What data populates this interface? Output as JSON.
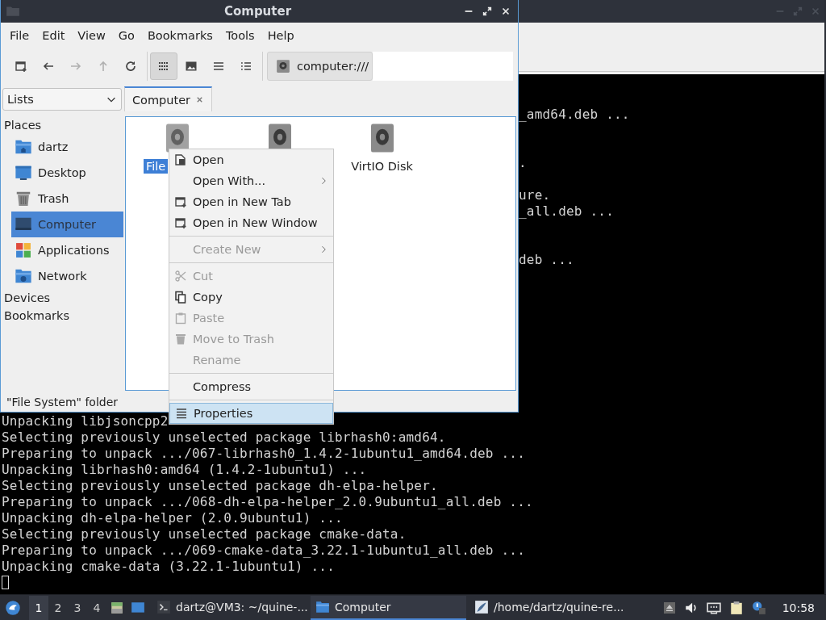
{
  "terminal": {
    "lines": [
      {
        "kind": "blank"
      },
      {
        "kind": "blank"
      },
      {
        "kind": "fragment",
        "text": "_amd64.deb ..."
      },
      {
        "kind": "blank"
      },
      {
        "kind": "blank"
      },
      {
        "kind": "fragment",
        "text": "."
      },
      {
        "kind": "blank"
      },
      {
        "kind": "fragment",
        "text": "ure."
      },
      {
        "kind": "fragment",
        "text": "_all.deb ..."
      },
      {
        "kind": "blank"
      },
      {
        "kind": "blank"
      },
      {
        "kind": "fragment",
        "text": "deb ..."
      },
      {
        "kind": "blank"
      },
      {
        "kind": "blank"
      },
      {
        "kind": "blank"
      },
      {
        "kind": "blank"
      },
      {
        "kind": "blank"
      },
      {
        "kind": "blank"
      },
      {
        "kind": "blank"
      },
      {
        "kind": "blank"
      },
      {
        "kind": "blank"
      },
      {
        "kind": "full",
        "text": "Unpacking libjsoncpp2"
      },
      {
        "kind": "full",
        "text": "Selecting previously unselected package librhash0:amd64."
      },
      {
        "kind": "full",
        "text": "Preparing to unpack .../067-librhash0_1.4.2-1ubuntu1_amd64.deb ..."
      },
      {
        "kind": "full",
        "text": "Unpacking librhash0:amd64 (1.4.2-1ubuntu1) ..."
      },
      {
        "kind": "full",
        "text": "Selecting previously unselected package dh-elpa-helper."
      },
      {
        "kind": "full",
        "text": "Preparing to unpack .../068-dh-elpa-helper_2.0.9ubuntu1_all.deb ..."
      },
      {
        "kind": "full",
        "text": "Unpacking dh-elpa-helper (2.0.9ubuntu1) ..."
      },
      {
        "kind": "full",
        "text": "Selecting previously unselected package cmake-data."
      },
      {
        "kind": "full",
        "text": "Preparing to unpack .../069-cmake-data_3.22.1-1ubuntu1_all.deb ..."
      },
      {
        "kind": "full",
        "text": "Unpacking cmake-data (3.22.1-1ubuntu1) ..."
      },
      {
        "kind": "cursor"
      }
    ]
  },
  "file_manager": {
    "window": {
      "title": "Computer"
    },
    "menu": [
      "File",
      "Edit",
      "View",
      "Go",
      "Bookmarks",
      "Tools",
      "Help"
    ],
    "toolbar": {
      "buttons": [
        {
          "disabled": false,
          "selected": false
        },
        {
          "disabled": false,
          "selected": false
        },
        {
          "disabled": true,
          "selected": false
        },
        {
          "disabled": true,
          "selected": false
        },
        {
          "disabled": false,
          "selected": false
        },
        {
          "disabled": false,
          "selected": true
        },
        {
          "disabled": false,
          "selected": false
        },
        {
          "disabled": false,
          "selected": false
        },
        {
          "disabled": false,
          "selected": false
        }
      ],
      "path_button": "computer:///"
    },
    "side_selector": "Lists",
    "tabs": [
      {
        "label": "Computer",
        "selected": true
      }
    ],
    "sidebar": {
      "sections": [
        {
          "title": "Places",
          "items": [
            {
              "label": "dartz",
              "selected": false
            },
            {
              "label": "Desktop",
              "selected": false
            },
            {
              "label": "Trash",
              "selected": false
            },
            {
              "label": "Computer",
              "selected": true
            },
            {
              "label": "Applications",
              "selected": false
            },
            {
              "label": "Network",
              "selected": false
            }
          ]
        },
        {
          "title": "Devices"
        },
        {
          "title": "Bookmarks"
        }
      ]
    },
    "items": [
      {
        "label": "File",
        "selected": true
      },
      {
        "selected": false
      },
      {
        "label": "VirtIO Disk",
        "selected": false
      }
    ],
    "status_bar": "\"File System\" folder"
  },
  "context_menu": {
    "groups": [
      [
        {
          "label": "Open",
          "disabled": false,
          "submenu": false,
          "selected": false
        },
        {
          "label": "Open With...",
          "disabled": false,
          "submenu": true,
          "selected": false
        },
        {
          "label": "Open in New Tab",
          "disabled": false,
          "submenu": false,
          "selected": false
        },
        {
          "label": "Open in New Window",
          "disabled": false,
          "submenu": false,
          "selected": false
        }
      ],
      [
        {
          "label": "Create New",
          "disabled": true,
          "submenu": true,
          "selected": false
        }
      ],
      [
        {
          "label": "Cut",
          "disabled": true,
          "submenu": false,
          "selected": false
        },
        {
          "label": "Copy",
          "disabled": false,
          "submenu": false,
          "selected": false
        },
        {
          "label": "Paste",
          "disabled": true,
          "submenu": false,
          "selected": false
        },
        {
          "label": "Move to Trash",
          "disabled": true,
          "submenu": false,
          "selected": false
        },
        {
          "label": "Rename",
          "disabled": true,
          "submenu": false,
          "selected": false
        }
      ],
      [
        {
          "label": "Compress",
          "disabled": false,
          "submenu": false,
          "selected": false
        }
      ],
      [
        {
          "label": "Properties",
          "disabled": false,
          "submenu": false,
          "selected": true
        }
      ]
    ]
  },
  "taskbar": {
    "workspaces": [
      {
        "label": "1",
        "selected": true
      },
      {
        "label": "2",
        "selected": false
      },
      {
        "label": "3",
        "selected": false
      },
      {
        "label": "4",
        "selected": false
      }
    ],
    "tasks": [
      {
        "label": "dartz@VM3: ~/quine-...",
        "selected": false
      },
      {
        "label": "Computer",
        "selected": true
      },
      {
        "label": "/home/dartz/quine-re...",
        "selected": false
      }
    ],
    "clock": "10:58"
  }
}
